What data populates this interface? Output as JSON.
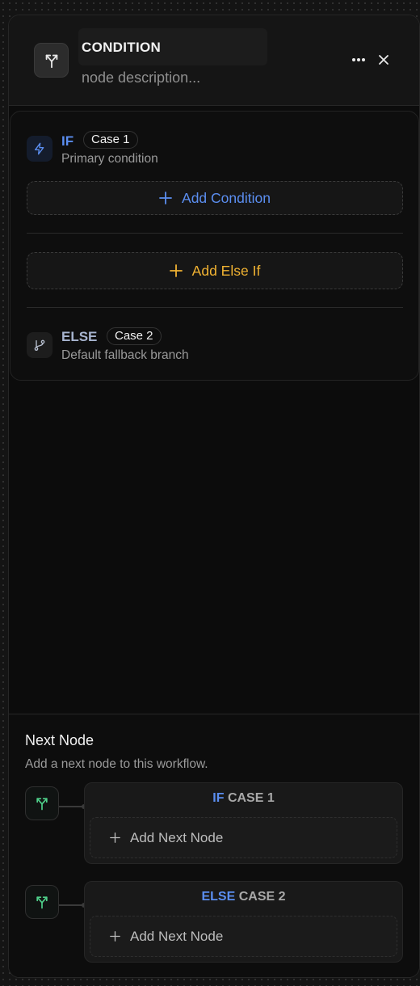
{
  "header": {
    "title": "CONDITION",
    "description_placeholder": "node description...",
    "icons": {
      "node": "split-arrows-icon",
      "more": "more-horizontal-icon",
      "close": "close-icon"
    }
  },
  "condition": {
    "if_branch": {
      "keyword": "IF",
      "badge": "Case 1",
      "subtitle": "Primary condition",
      "icon": "lightning-icon"
    },
    "add_condition_label": "Add Condition",
    "add_else_if_label": "Add Else If",
    "else_branch": {
      "keyword": "ELSE",
      "badge": "Case 2",
      "subtitle": "Default fallback branch",
      "icon": "git-branch-icon"
    }
  },
  "next_node": {
    "title": "Next Node",
    "subtitle": "Add a next node to this workflow.",
    "targets": [
      {
        "keyword": "IF",
        "case": "CASE 1",
        "add_label": "Add Next Node"
      },
      {
        "keyword": "ELSE",
        "case": "CASE 2",
        "add_label": "Add Next Node"
      }
    ]
  },
  "colors": {
    "if_blue": "#5b8ef0",
    "else_yellow": "#f0b232",
    "branch_green": "#4fd08a"
  }
}
